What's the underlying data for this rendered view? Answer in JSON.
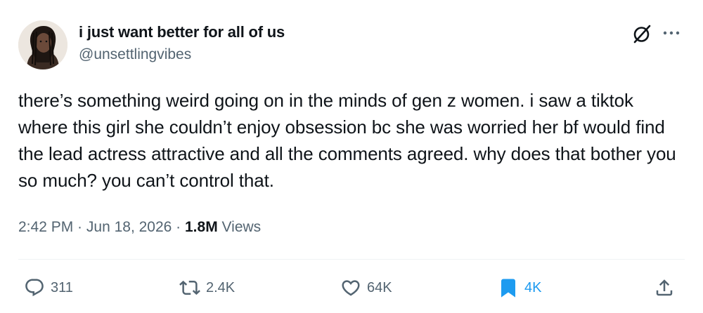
{
  "author": {
    "display_name": "i just want better for all of us",
    "handle": "@unsettlingvibes"
  },
  "tweet": {
    "text": "there’s something weird going on in the minds of gen z women. i saw a tiktok where this girl she couldn’t enjoy obsession bc she was worried her bf would find the lead actress attractive and all the comments agreed. why does that bother you so much? you can’t control that."
  },
  "meta": {
    "time": "2:42 PM",
    "separator": " · ",
    "date": "Jun 18, 2026",
    "views_count": "1.8M",
    "views_label": " Views"
  },
  "actions": {
    "reply": {
      "icon": "reply-icon",
      "count": "311"
    },
    "retweet": {
      "icon": "retweet-icon",
      "count": "2.4K"
    },
    "like": {
      "icon": "heart-icon",
      "count": "64K"
    },
    "bookmark": {
      "icon": "bookmark-icon",
      "count": "4K",
      "active": true
    },
    "share": {
      "icon": "share-icon"
    }
  },
  "colors": {
    "text": "#0f1419",
    "muted": "#536471",
    "accent": "#1d9bf0",
    "divider": "#eff3f4"
  }
}
